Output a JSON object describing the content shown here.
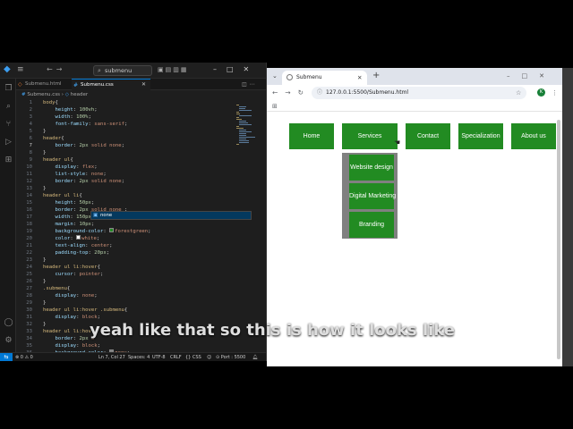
{
  "vscode": {
    "search_text": "submenu",
    "tabs": [
      {
        "label": "Submenu.html"
      },
      {
        "label": "Submenu.css"
      }
    ],
    "breadcrumb": {
      "file": "Submenu.css",
      "symbol": "header"
    },
    "line_numbers": [
      "1",
      "2",
      "3",
      "4",
      "5",
      "6",
      "7",
      "8",
      "9",
      "10",
      "11",
      "12",
      "13",
      "14",
      "15",
      "16",
      "17",
      "18",
      "19",
      "20",
      "21",
      "22",
      "23",
      "24",
      "25",
      "26",
      "27",
      "28",
      "29",
      "30",
      "31",
      "32",
      "33",
      "34",
      "35",
      "36"
    ],
    "code": [
      "body{",
      "    height: 100vh;",
      "    width: 100%;",
      "    font-family: sans-serif;",
      "}",
      "header{",
      "    border: 2px solid none;",
      "}",
      "header ul{",
      "    display: flex;",
      "    list-style: none;",
      "    border: 2px solid none;",
      "}",
      "header ul li{",
      "    height: 50px;",
      "    border: 2px solid none ;",
      "    width: 150px;",
      "    margin: 10px;",
      "    background-color: forestgreen;",
      "    color: white;",
      "    text-align: center;",
      "    padding-top: 20px;",
      "}",
      "header ul li:hover{",
      "    cursor: pointer;",
      "}",
      ".submenu{",
      "    display: none;",
      "}",
      "header ul li:hover .submenu{",
      "    display: block;",
      "}",
      "header ul li:hov",
      "    border: 2px s",
      "    display: block;",
      "    background-color: grey;"
    ],
    "suggestion": "none",
    "status": {
      "errors": "0",
      "warnings": "0",
      "position": "Ln 7, Col 27",
      "spaces": "Spaces: 4",
      "encoding": "UTF-8",
      "eol": "CRLF",
      "language": "CSS",
      "port": "Port : 5500"
    },
    "colors": {
      "accent": "#0078d4",
      "forestgreen": "#228b22",
      "white": "#ffffff",
      "grey": "#808080"
    }
  },
  "chrome": {
    "tab_title": "Submenu",
    "url": "127.0.0.1:5500/Submenu.html",
    "profile_initial": "K"
  },
  "page": {
    "nav": [
      "Home",
      "Services",
      "Contact",
      "Specialization",
      "About us"
    ],
    "submenu": [
      "Website design",
      "Digital Marketing",
      "Branding"
    ],
    "colors": {
      "item": "forestgreen",
      "submenu_bg": "#808080"
    }
  },
  "caption": "yeah like that so this is how it looks like"
}
